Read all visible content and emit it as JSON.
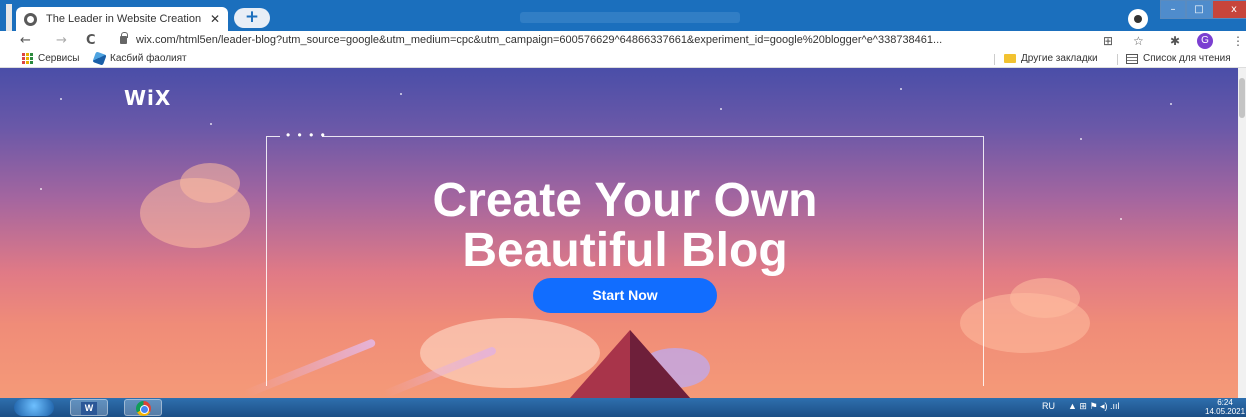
{
  "browser": {
    "tab": {
      "title": "The Leader in Website Creation |",
      "close": "✕"
    },
    "new_tab": "+",
    "window_buttons": {
      "minimize": "–",
      "maximize": "□",
      "close": "x"
    },
    "nav": {
      "back": "←",
      "forward": "→",
      "reload": "C"
    },
    "url": "wix.com/html5en/leader-blog?utm_source=google&utm_medium=cpc&utm_campaign=600576629^64866337661&experiment_id=google%20blogger^e^338738461...",
    "address_icons": {
      "translate": "⊞",
      "star": "☆",
      "extensions": "✱"
    },
    "avatar": "G",
    "menu": "⋮"
  },
  "bookmarks": {
    "apps": "Сервисы",
    "item1": "Касбий фаолият",
    "other": "Другие закладки",
    "reading_list": "Список для чтения"
  },
  "hero": {
    "logo": "WiX",
    "frame_dots": "• • • •",
    "headline_line1": "Create Your Own",
    "headline_line2": "Beautiful Blog",
    "cta": "Start Now"
  },
  "taskbar": {
    "word_label": "W",
    "lang": "RU",
    "tray_icons": "▲  ⊞  ⚑  ◂)  .ııl",
    "time": "6:24",
    "date": "14.05.2021"
  },
  "colors": {
    "tabbar": "#1b6fbd",
    "cta": "#116dff",
    "hero_top": "#4a4ea8",
    "hero_bottom": "#f59a78"
  }
}
